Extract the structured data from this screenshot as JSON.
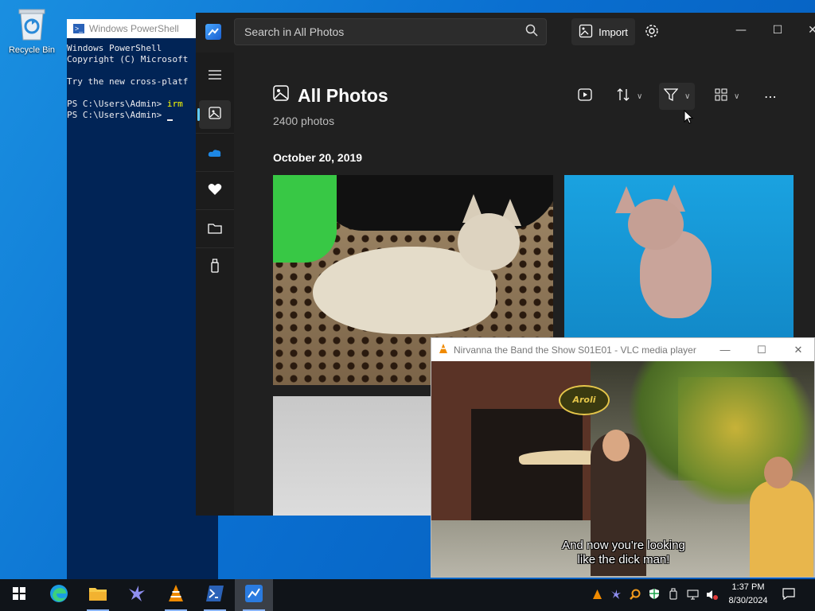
{
  "desktop": {
    "recycle_bin_label": "Recycle Bin"
  },
  "powershell": {
    "title": "Windows PowerShell",
    "lines": [
      "Windows PowerShell",
      "Copyright (C) Microsoft",
      "",
      "Try the new cross-platf",
      ""
    ],
    "prompt1": "PS C:\\Users\\Admin> ",
    "cmd1": "irm",
    "prompt2": "PS C:\\Users\\Admin> "
  },
  "photos": {
    "search_placeholder": "Search in All Photos",
    "import_label": "Import",
    "page_title": "All Photos",
    "photo_count": "2400 photos",
    "date_group": "October 20, 2019"
  },
  "vlc": {
    "title": "Nirvanna the Band the Show S01E01 - VLC media player",
    "subtitle_line1": "And now you're looking",
    "subtitle_line2": "like the dick man!",
    "sign_text": "Aroli"
  },
  "taskbar": {
    "time": "1:37 PM",
    "date": "8/30/2024"
  },
  "colors": {
    "desktop": "#0a6fd0",
    "photos_bg": "#202020",
    "accent": "#60cdff",
    "powershell_bg": "#012456"
  }
}
